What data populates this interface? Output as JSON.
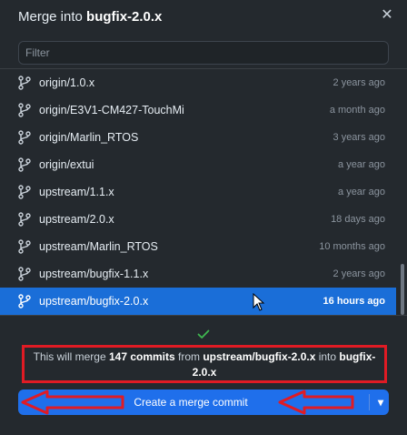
{
  "dialog": {
    "title_prefix": "Merge into ",
    "title_branch": "bugfix-2.0.x",
    "close_glyph": "✕"
  },
  "filter": {
    "placeholder": "Filter",
    "value": ""
  },
  "branches": [
    {
      "name": "origin/1.0.x",
      "time": "2 years ago"
    },
    {
      "name": "origin/E3V1-CM427-TouchMi",
      "time": "a month ago"
    },
    {
      "name": "origin/Marlin_RTOS",
      "time": "3 years ago"
    },
    {
      "name": "origin/extui",
      "time": "a year ago"
    },
    {
      "name": "upstream/1.1.x",
      "time": "a year ago"
    },
    {
      "name": "upstream/2.0.x",
      "time": "18 days ago"
    },
    {
      "name": "upstream/Marlin_RTOS",
      "time": "10 months ago"
    },
    {
      "name": "upstream/bugfix-1.1.x",
      "time": "2 years ago"
    },
    {
      "name": "upstream/bugfix-2.0.x",
      "time": "16 hours ago",
      "selected": true
    }
  ],
  "merge_message": {
    "part1": "This will merge ",
    "count": "147 commits",
    "part2": " from ",
    "source": "upstream/bugfix-2.0.x",
    "part3": " into ",
    "target": "bugfix-2.0.x"
  },
  "merge_button": {
    "label": "Create a merge commit",
    "dropdown_glyph": "▾"
  },
  "colors": {
    "background": "#24292e",
    "selected_row": "#1a6ed8",
    "button": "#1f6feb",
    "annotation_red": "#e01b24",
    "check_green": "#3fb950"
  },
  "icons": {
    "branch": "git-branch-icon",
    "check": "check-icon",
    "close": "close-icon",
    "dropdown": "chevron-down-icon"
  }
}
